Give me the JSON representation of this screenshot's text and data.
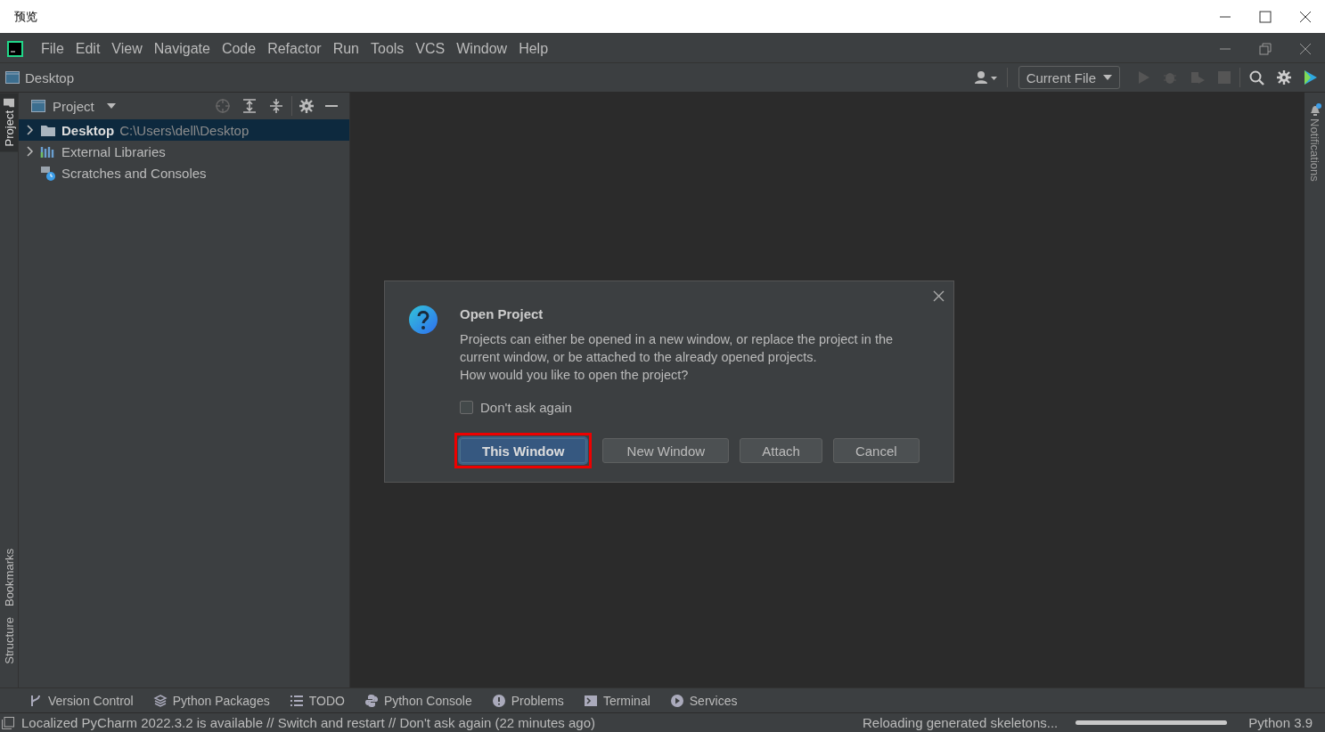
{
  "outer_window": {
    "title": "预览"
  },
  "menu_bar": {
    "items": [
      "File",
      "Edit",
      "View",
      "Navigate",
      "Code",
      "Refactor",
      "Run",
      "Tools",
      "VCS",
      "Window",
      "Help"
    ]
  },
  "nav_bar": {
    "breadcrumb": "Desktop",
    "run_config": "Current File"
  },
  "left_stripe": {
    "top": [
      {
        "label": "Project",
        "selected": true
      }
    ],
    "bottom": [
      {
        "label": "Bookmarks",
        "selected": false
      },
      {
        "label": "Structure",
        "selected": false
      }
    ]
  },
  "project_panel": {
    "title": "Project",
    "tree": [
      {
        "kind": "folder",
        "label": "Desktop",
        "path": "C:\\Users\\dell\\Desktop",
        "selected": true,
        "expanded": false
      },
      {
        "kind": "libraries",
        "label": "External Libraries",
        "selected": false,
        "expanded": false
      },
      {
        "kind": "scratches",
        "label": "Scratches and Consoles",
        "selected": false
      }
    ]
  },
  "right_stripe": {
    "items": [
      {
        "label": "Notifications"
      }
    ]
  },
  "dialog": {
    "title": "Open Project",
    "message": "Projects can either be opened in a new window, or replace the project in the current window, or be attached to the already opened projects.\nHow would you like to open the project?",
    "checkbox": {
      "label": "Don't ask again",
      "checked": false
    },
    "buttons": [
      {
        "label": "This Window",
        "default": true,
        "highlighted": true
      },
      {
        "label": "New Window",
        "default": false,
        "highlighted": false
      },
      {
        "label": "Attach",
        "default": false,
        "highlighted": false
      },
      {
        "label": "Cancel",
        "default": false,
        "highlighted": false
      }
    ]
  },
  "tool_windows": [
    {
      "label": "Version Control"
    },
    {
      "label": "Python Packages"
    },
    {
      "label": "TODO"
    },
    {
      "label": "Python Console"
    },
    {
      "label": "Problems"
    },
    {
      "label": "Terminal"
    },
    {
      "label": "Services"
    }
  ],
  "status_bar": {
    "message": "Localized PyCharm 2022.3.2 is available // Switch and restart // Don't ask again (22 minutes ago)",
    "task": "Reloading generated skeletons...",
    "level": 1,
    "interpreter": "Python 3.9"
  }
}
